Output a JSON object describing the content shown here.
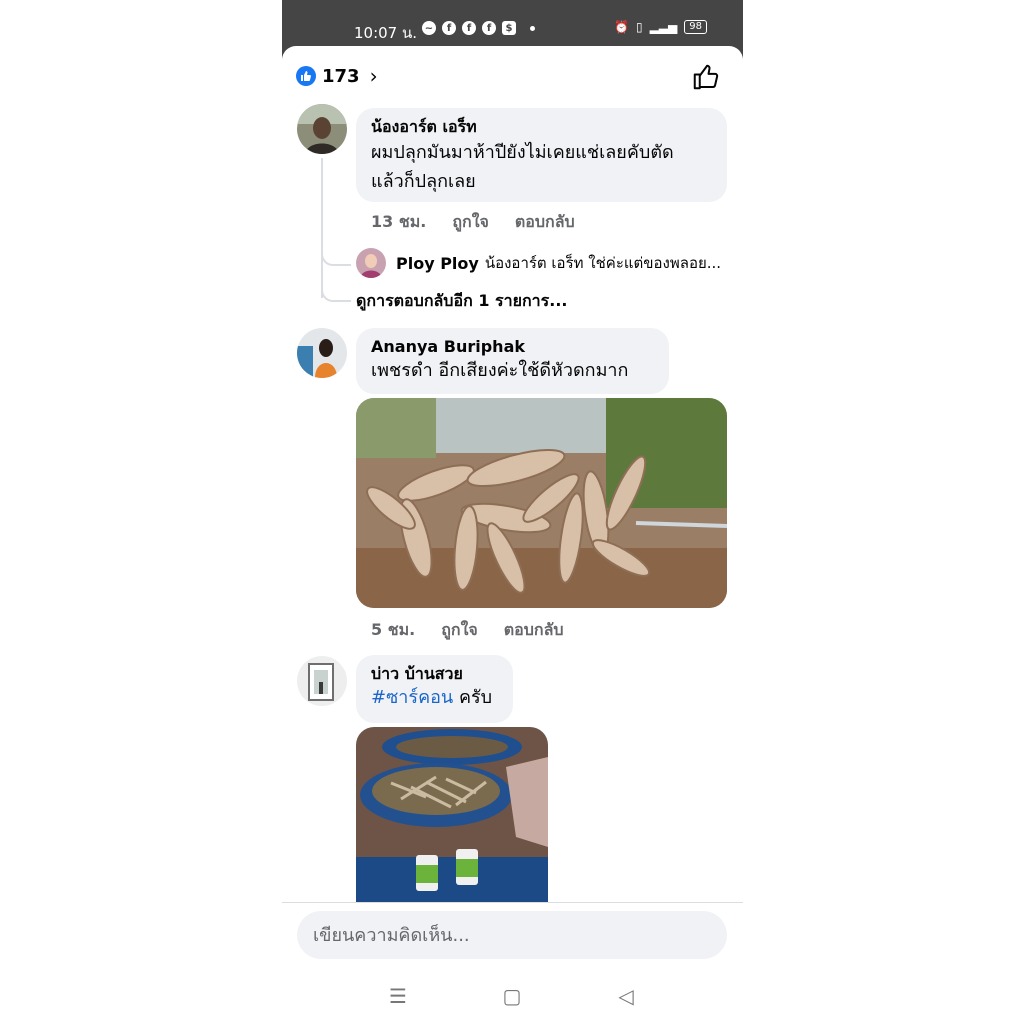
{
  "status_bar": {
    "time": "10:07 น.",
    "battery": "98"
  },
  "reactions": {
    "count": "173",
    "chevron": "›"
  },
  "comments": [
    {
      "name": "น้องอาร์ต เอร็ท",
      "text_line1": "ผมปลุกมันมาห้าปียังไม่เคยแช่เลยคับตัด",
      "text_line2": "แล้วก็ปลุกเลย",
      "time": "13 ชม.",
      "like": "ถูกใจ",
      "reply": "ตอบกลับ",
      "reply_preview": {
        "name": "Ploy Ploy",
        "text": "น้องอาร์ต เอร็ท ใช่ค่ะแต่ของพลอย..."
      },
      "more_replies": "ดูการตอบกลับอีก 1 รายการ..."
    },
    {
      "name": "Ananya Buriphak",
      "text": "เพชรดำ อีกเสียงค่ะใช้ดีหัวดกมาก",
      "time": "5 ชม.",
      "like": "ถูกใจ",
      "reply": "ตอบกลับ"
    },
    {
      "name": "บ่าว บ้านสวย",
      "hashtag": "#ซาร์คอน",
      "text_after": " ครับ"
    }
  ],
  "composer": {
    "placeholder": "เขียนความคิดเห็น..."
  },
  "nav": {
    "menu": "☰",
    "home": "▢",
    "back": "◁"
  }
}
